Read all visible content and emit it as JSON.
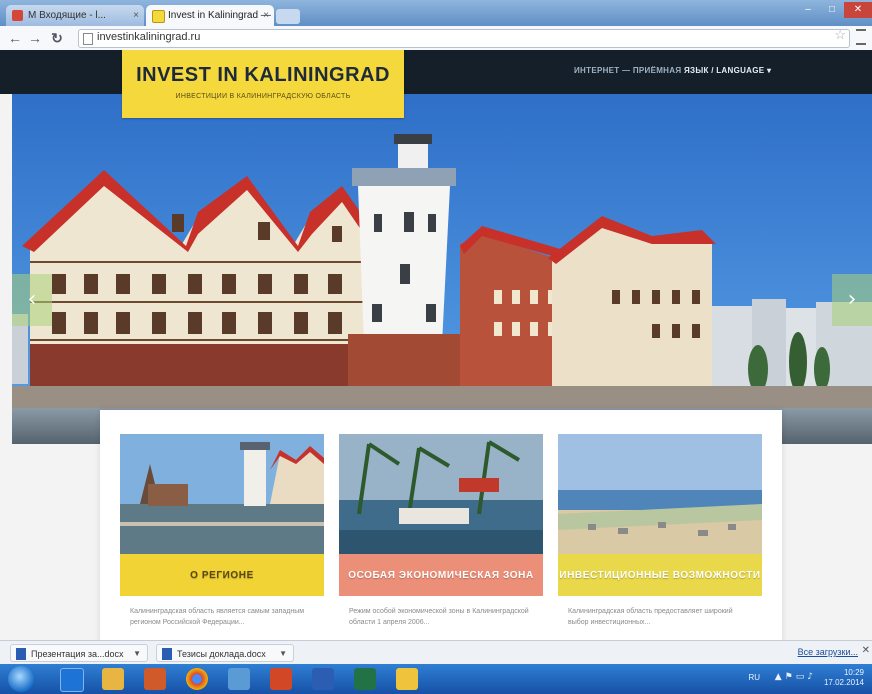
{
  "browser": {
    "tabs": [
      {
        "label": "M Входящие - l...",
        "active": false
      },
      {
        "label": "Invest in Kaliningrad — In...",
        "active": true
      }
    ],
    "address": "investinkaliningrad.ru",
    "window_controls": {
      "minimize": "–",
      "maximize": "□",
      "close": "✕"
    }
  },
  "site": {
    "logo_title": "INVEST IN KALININGRAD",
    "logo_subtitle": "ИНВЕСТИЦИИ В КАЛИНИНГРАДСКУЮ ОБЛАСТЬ",
    "nav": {
      "reception": "ИНТЕРНЕТ — ПРИЁМНАЯ",
      "language": "ЯЗЫК / LANGUAGE ▾"
    },
    "slider": {
      "prev": "‹",
      "next": "›"
    },
    "cards": [
      {
        "title": "О РЕГИОНЕ",
        "title_color": "#f2d335",
        "text": "Калининградская область является самым западным регионом Российской Федерации..."
      },
      {
        "title": "ОСОБАЯ ЭКОНОМИЧЕСКАЯ ЗОНА",
        "title_color": "#ec8f78",
        "text": "Режим особой экономической зоны в Калининградской области 1 апреля 2006..."
      },
      {
        "title": "ИНВЕСТИЦИОННЫЕ ВОЗМОЖНОСТИ",
        "title_color": "#e9d94a",
        "text": "Калининградская область предоставляет широкий выбор инвестиционных..."
      }
    ]
  },
  "downloads": {
    "items": [
      {
        "name": "Презентация за...docx"
      },
      {
        "name": "Тезисы доклада.docx"
      }
    ],
    "show_all": "Все загрузки...",
    "close": "✕"
  },
  "taskbar": {
    "language": "RU",
    "time": "10:29",
    "date": "17.02.2014"
  }
}
